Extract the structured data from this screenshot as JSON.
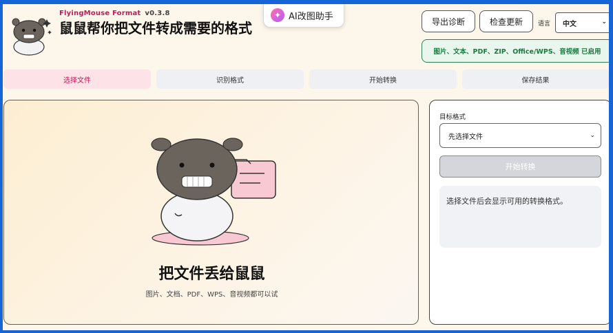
{
  "app": {
    "name": "FlyingMouse Format",
    "version": "v0.3.8",
    "headline": "鼠鼠帮你把文件转成需要的格式"
  },
  "header": {
    "ai_assistant_label": "AI改图助手",
    "export_diagnostics_label": "导出诊断",
    "check_updates_label": "检查更新",
    "language_label": "语言",
    "language_value": "中文",
    "enabled_formats_text": "图片、文本、PDF、ZIP、Office/WPS、音视频 已启用"
  },
  "steps": [
    {
      "label": "选择文件",
      "active": true
    },
    {
      "label": "识别格式",
      "active": false
    },
    {
      "label": "开始转换",
      "active": false
    },
    {
      "label": "保存结果",
      "active": false
    }
  ],
  "dropzone": {
    "title": "把文件丢给鼠鼠",
    "subtitle": "图片、文档、PDF、WPS、音视频都可以试"
  },
  "panel": {
    "target_format_label": "目标格式",
    "target_format_value": "先选择文件",
    "start_button_label": "开始转换",
    "hint_text": "选择文件后会显示可用的转换格式。"
  },
  "colors": {
    "accent": "#c2185b",
    "enabled_green": "#1b7a3f",
    "page_bg": "#fdf6ea"
  }
}
